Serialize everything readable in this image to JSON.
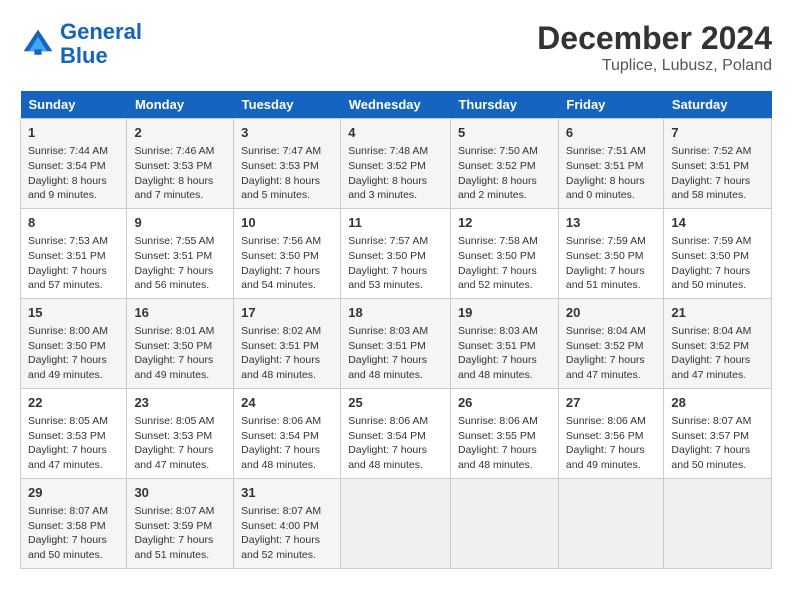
{
  "header": {
    "logo_line1": "General",
    "logo_line2": "Blue",
    "month_year": "December 2024",
    "location": "Tuplice, Lubusz, Poland"
  },
  "days_of_week": [
    "Sunday",
    "Monday",
    "Tuesday",
    "Wednesday",
    "Thursday",
    "Friday",
    "Saturday"
  ],
  "weeks": [
    [
      {
        "day": "1",
        "info": "Sunrise: 7:44 AM\nSunset: 3:54 PM\nDaylight: 8 hours\nand 9 minutes."
      },
      {
        "day": "2",
        "info": "Sunrise: 7:46 AM\nSunset: 3:53 PM\nDaylight: 8 hours\nand 7 minutes."
      },
      {
        "day": "3",
        "info": "Sunrise: 7:47 AM\nSunset: 3:53 PM\nDaylight: 8 hours\nand 5 minutes."
      },
      {
        "day": "4",
        "info": "Sunrise: 7:48 AM\nSunset: 3:52 PM\nDaylight: 8 hours\nand 3 minutes."
      },
      {
        "day": "5",
        "info": "Sunrise: 7:50 AM\nSunset: 3:52 PM\nDaylight: 8 hours\nand 2 minutes."
      },
      {
        "day": "6",
        "info": "Sunrise: 7:51 AM\nSunset: 3:51 PM\nDaylight: 8 hours\nand 0 minutes."
      },
      {
        "day": "7",
        "info": "Sunrise: 7:52 AM\nSunset: 3:51 PM\nDaylight: 7 hours\nand 58 minutes."
      }
    ],
    [
      {
        "day": "8",
        "info": "Sunrise: 7:53 AM\nSunset: 3:51 PM\nDaylight: 7 hours\nand 57 minutes."
      },
      {
        "day": "9",
        "info": "Sunrise: 7:55 AM\nSunset: 3:51 PM\nDaylight: 7 hours\nand 56 minutes."
      },
      {
        "day": "10",
        "info": "Sunrise: 7:56 AM\nSunset: 3:50 PM\nDaylight: 7 hours\nand 54 minutes."
      },
      {
        "day": "11",
        "info": "Sunrise: 7:57 AM\nSunset: 3:50 PM\nDaylight: 7 hours\nand 53 minutes."
      },
      {
        "day": "12",
        "info": "Sunrise: 7:58 AM\nSunset: 3:50 PM\nDaylight: 7 hours\nand 52 minutes."
      },
      {
        "day": "13",
        "info": "Sunrise: 7:59 AM\nSunset: 3:50 PM\nDaylight: 7 hours\nand 51 minutes."
      },
      {
        "day": "14",
        "info": "Sunrise: 7:59 AM\nSunset: 3:50 PM\nDaylight: 7 hours\nand 50 minutes."
      }
    ],
    [
      {
        "day": "15",
        "info": "Sunrise: 8:00 AM\nSunset: 3:50 PM\nDaylight: 7 hours\nand 49 minutes."
      },
      {
        "day": "16",
        "info": "Sunrise: 8:01 AM\nSunset: 3:50 PM\nDaylight: 7 hours\nand 49 minutes."
      },
      {
        "day": "17",
        "info": "Sunrise: 8:02 AM\nSunset: 3:51 PM\nDaylight: 7 hours\nand 48 minutes."
      },
      {
        "day": "18",
        "info": "Sunrise: 8:03 AM\nSunset: 3:51 PM\nDaylight: 7 hours\nand 48 minutes."
      },
      {
        "day": "19",
        "info": "Sunrise: 8:03 AM\nSunset: 3:51 PM\nDaylight: 7 hours\nand 48 minutes."
      },
      {
        "day": "20",
        "info": "Sunrise: 8:04 AM\nSunset: 3:52 PM\nDaylight: 7 hours\nand 47 minutes."
      },
      {
        "day": "21",
        "info": "Sunrise: 8:04 AM\nSunset: 3:52 PM\nDaylight: 7 hours\nand 47 minutes."
      }
    ],
    [
      {
        "day": "22",
        "info": "Sunrise: 8:05 AM\nSunset: 3:53 PM\nDaylight: 7 hours\nand 47 minutes."
      },
      {
        "day": "23",
        "info": "Sunrise: 8:05 AM\nSunset: 3:53 PM\nDaylight: 7 hours\nand 47 minutes."
      },
      {
        "day": "24",
        "info": "Sunrise: 8:06 AM\nSunset: 3:54 PM\nDaylight: 7 hours\nand 48 minutes."
      },
      {
        "day": "25",
        "info": "Sunrise: 8:06 AM\nSunset: 3:54 PM\nDaylight: 7 hours\nand 48 minutes."
      },
      {
        "day": "26",
        "info": "Sunrise: 8:06 AM\nSunset: 3:55 PM\nDaylight: 7 hours\nand 48 minutes."
      },
      {
        "day": "27",
        "info": "Sunrise: 8:06 AM\nSunset: 3:56 PM\nDaylight: 7 hours\nand 49 minutes."
      },
      {
        "day": "28",
        "info": "Sunrise: 8:07 AM\nSunset: 3:57 PM\nDaylight: 7 hours\nand 50 minutes."
      }
    ],
    [
      {
        "day": "29",
        "info": "Sunrise: 8:07 AM\nSunset: 3:58 PM\nDaylight: 7 hours\nand 50 minutes."
      },
      {
        "day": "30",
        "info": "Sunrise: 8:07 AM\nSunset: 3:59 PM\nDaylight: 7 hours\nand 51 minutes."
      },
      {
        "day": "31",
        "info": "Sunrise: 8:07 AM\nSunset: 4:00 PM\nDaylight: 7 hours\nand 52 minutes."
      },
      null,
      null,
      null,
      null
    ]
  ]
}
